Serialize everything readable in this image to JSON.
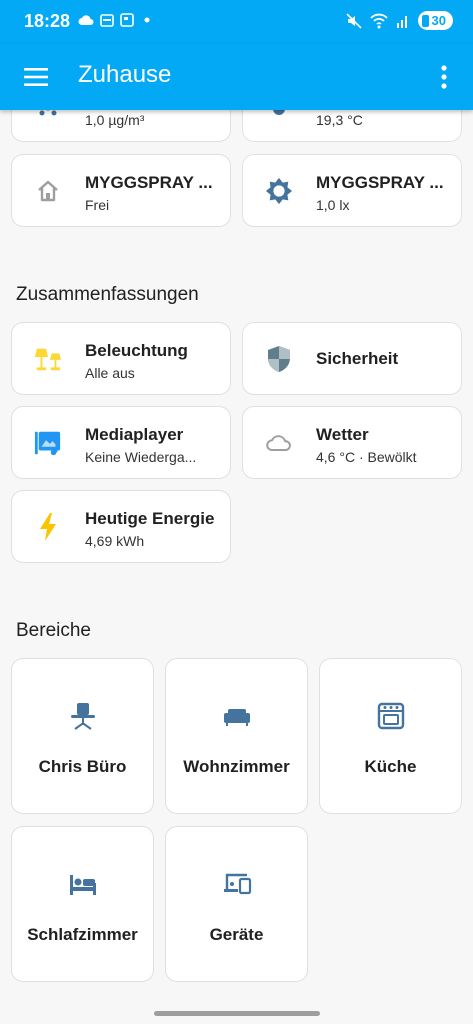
{
  "status_bar": {
    "time": "18:28",
    "battery": "30"
  },
  "app_bar": {
    "title": "Zuhause"
  },
  "top_tiles": [
    {
      "state": "1,0 µg/m³"
    },
    {
      "state": "19,3 °C"
    }
  ],
  "sensor_tiles": [
    {
      "name": "MYGGSPRAY ...",
      "state": "Frei",
      "icon": "home-outline-icon"
    },
    {
      "name": "MYGGSPRAY ...",
      "state": "1,0 lx",
      "icon": "brightness-icon"
    }
  ],
  "summaries": {
    "title": "Zusammenfassungen",
    "items": [
      {
        "name": "Beleuchtung",
        "state": "Alle aus",
        "icon": "lamps-icon"
      },
      {
        "name": "Sicherheit",
        "state": "",
        "icon": "shield-icon"
      },
      {
        "name": "Mediaplayer",
        "state": "Keine Wiederga...",
        "icon": "media-icon"
      },
      {
        "name": "Wetter",
        "state": "4,6 °C · Bewölkt",
        "icon": "cloud-icon"
      },
      {
        "name": "Heutige Energie",
        "state": "4,69 kWh",
        "icon": "lightning-icon"
      }
    ]
  },
  "areas": {
    "title": "Bereiche",
    "items": [
      {
        "name": "Chris Büro",
        "icon": "desk-chair-icon"
      },
      {
        "name": "Wohnzimmer",
        "icon": "sofa-icon"
      },
      {
        "name": "Küche",
        "icon": "stove-icon"
      },
      {
        "name": "Schlafzimmer",
        "icon": "bed-icon"
      },
      {
        "name": "Geräte",
        "icon": "devices-icon"
      }
    ]
  },
  "colors": {
    "primary": "#03a9f4",
    "icon_blue": "#44739e",
    "lamp_yellow": "#fdd835",
    "energy_yellow": "#f9c400"
  }
}
